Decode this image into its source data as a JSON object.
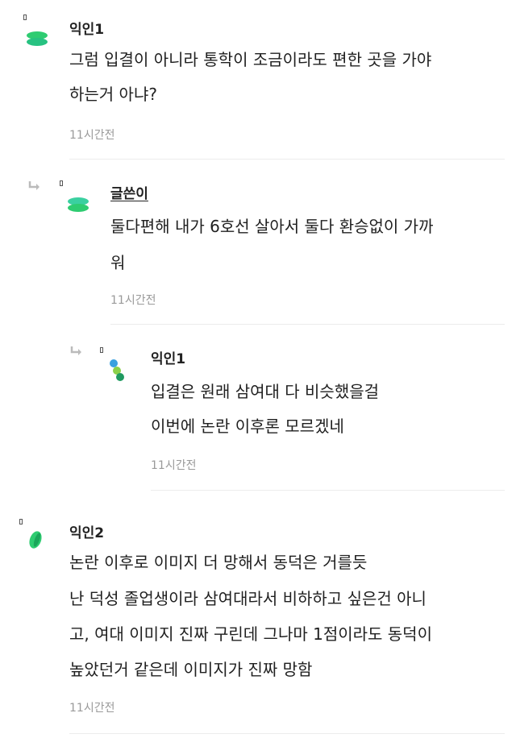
{
  "comments": [
    {
      "author": "익인1",
      "lines": [
        "그럼 입결이 아니라 통학이 조금이라도 편한 곳을 가야",
        "하는거 아냐?"
      ],
      "time": "11시간전",
      "avatar": "green-pill-stack"
    },
    {
      "author": "글쓴이",
      "lines": [
        "둘다편해 내가 6호선 살아서 둘다 환승없이 가까",
        "워"
      ],
      "time": "11시간전",
      "avatar": "green-pill-stack"
    },
    {
      "author": "익인1",
      "lines": [
        "입결은 원래 삼여대 다 비슷했을걸",
        "이번에 논란 이후론 모르겠네"
      ],
      "time": "11시간전",
      "avatar": "multicolor-dots"
    },
    {
      "author": "익인2",
      "lines": [
        "논란 이후로 이미지 더 망해서 동덕은 거를듯",
        "난 덕성 졸업생이라 삼여대라서 비하하고 싶은건 아니",
        "고, 여대 이미지 진짜 구린데 그나마 1점이라도 동덕이",
        "높았던거 같은데 이미지가 진짜 망함"
      ],
      "time": "11시간전",
      "avatar": "green-leaf"
    }
  ],
  "colors": {
    "avatar_green": "#2ecc71",
    "avatar_teal": "#3ad0a0",
    "time_gray": "#9a9a9a",
    "divider": "#ececec"
  }
}
